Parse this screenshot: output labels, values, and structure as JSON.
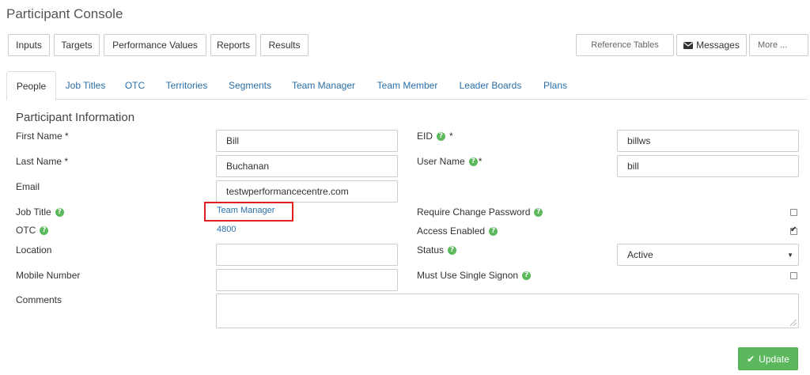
{
  "app": {
    "title": "Participant Console"
  },
  "toolbar": {
    "inputs": "Inputs",
    "targets": "Targets",
    "performance_values": "Performance Values",
    "reports": "Reports",
    "results": "Results",
    "reference_tables": "Reference Tables",
    "messages": "Messages",
    "more": "More ..."
  },
  "tabs": {
    "people": "People",
    "job_titles": "Job Titles",
    "otc": "OTC",
    "territories": "Territories",
    "segments": "Segments",
    "team_manager": "Team Manager",
    "team_member": "Team Member",
    "leader_boards": "Leader Boards",
    "plans": "Plans",
    "active": "People"
  },
  "form": {
    "section_title": "Participant Information",
    "first_name": {
      "label": "First Name *",
      "value": "Bill"
    },
    "last_name": {
      "label": "Last Name *",
      "value": "Buchanan"
    },
    "email": {
      "label": "Email",
      "value": "testwperformancecentre.com"
    },
    "job_title": {
      "label": "Job Title",
      "value": "Team Manager"
    },
    "otc": {
      "label": "OTC",
      "value": "4800"
    },
    "location": {
      "label": "Location",
      "value": ""
    },
    "mobile_number": {
      "label": "Mobile Number",
      "value": ""
    },
    "comments": {
      "label": "Comments",
      "value": ""
    },
    "eid": {
      "label": "EID",
      "required": "*",
      "value": "billws"
    },
    "user_name": {
      "label": "User Name",
      "required": "*",
      "value": "bill"
    },
    "require_change_password": {
      "label": "Require Change Password",
      "checked": false
    },
    "access_enabled": {
      "label": "Access Enabled",
      "checked": true
    },
    "status": {
      "label": "Status",
      "value": "Active"
    },
    "must_use_single_signon": {
      "label": "Must Use Single Signon",
      "checked": false
    }
  },
  "actions": {
    "update": "Update"
  },
  "colors": {
    "link": "#2a6fa8",
    "help_icon": "#5cb85c",
    "update_button": "#5cb85c",
    "highlight_box": "#e02020"
  },
  "icons": {
    "help": "question-circle-icon",
    "messages": "envelope-icon",
    "update": "check-icon",
    "status_caret": "caret-down-icon"
  }
}
